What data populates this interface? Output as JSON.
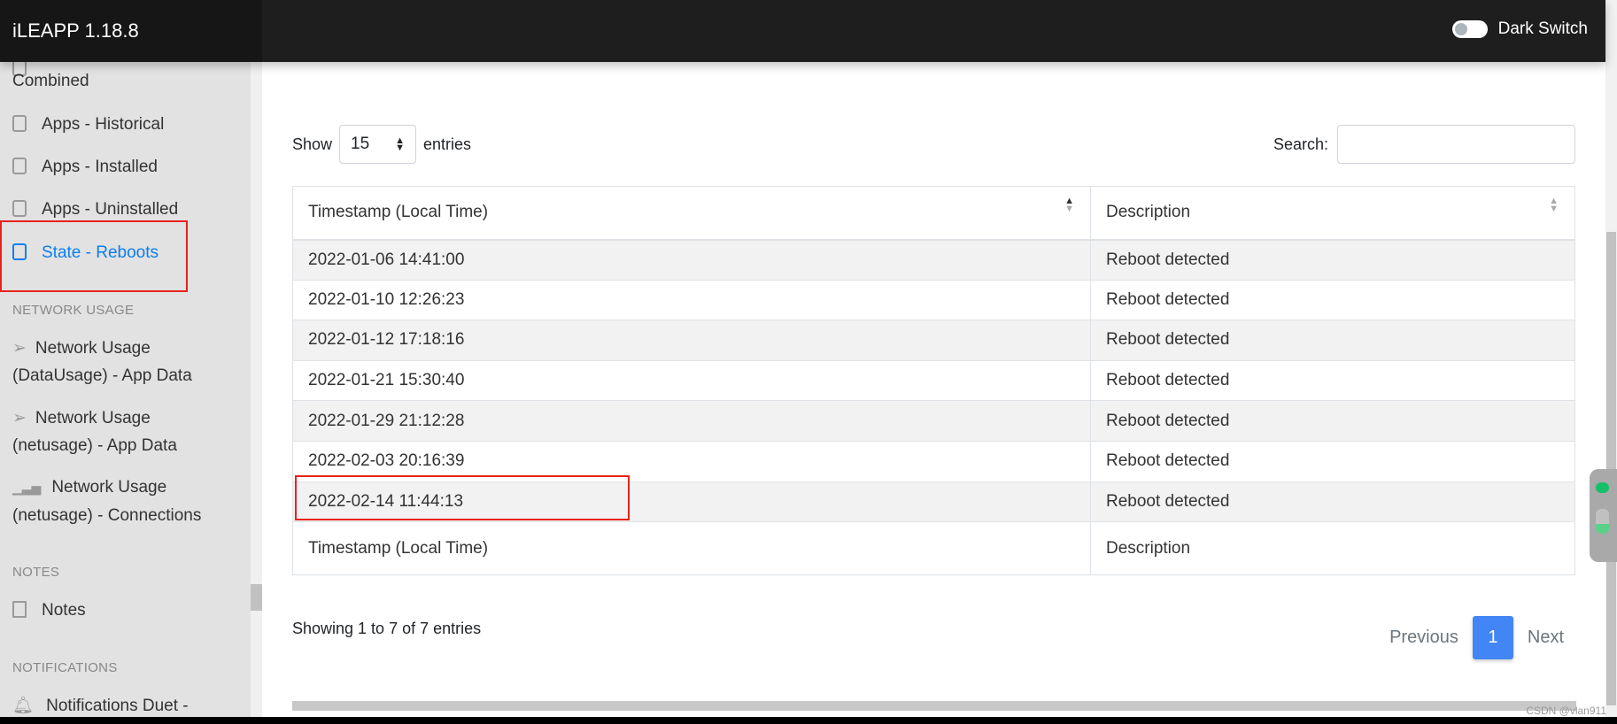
{
  "header": {
    "title": "iLEAPP 1.18.8",
    "dark_switch_label": "Dark Switch",
    "dark_switch_on": false
  },
  "sidebar": {
    "items": [
      {
        "label": "Combined"
      },
      {
        "label": "Apps - Historical",
        "icon": "clipboard-icon"
      },
      {
        "label": "Apps - Installed",
        "icon": "clipboard-icon"
      },
      {
        "label": "Apps - Uninstalled",
        "icon": "clipboard-icon"
      },
      {
        "label": "State - Reboots",
        "icon": "clipboard-icon",
        "active": true
      },
      {
        "label": "Network Usage (DataUsage) - App Data",
        "icon": "send-icon"
      },
      {
        "label": "Network Usage (netusage) - App Data",
        "icon": "send-icon"
      },
      {
        "label": "Network Usage (netusage) - Connections",
        "icon": "bar-chart-icon"
      },
      {
        "label": "Notes",
        "icon": "file-text-icon"
      },
      {
        "label": "Notifications Duet -",
        "icon": "bell-icon"
      }
    ],
    "sections": [
      "NETWORK USAGE",
      "NOTES",
      "NOTIFICATIONS"
    ]
  },
  "controls": {
    "show_label": "Show",
    "entries_value": "15",
    "entries_label": "entries",
    "search_label": "Search:",
    "search_value": ""
  },
  "table": {
    "columns": [
      "Timestamp (Local Time)",
      "Description"
    ],
    "rows": [
      [
        "2022-01-06 14:41:00",
        "Reboot detected"
      ],
      [
        "2022-01-10 12:26:23",
        "Reboot detected"
      ],
      [
        "2022-01-12 17:18:16",
        "Reboot detected"
      ],
      [
        "2022-01-21 15:30:40",
        "Reboot detected"
      ],
      [
        "2022-01-29 21:12:28",
        "Reboot detected"
      ],
      [
        "2022-02-03 20:16:39",
        "Reboot detected"
      ],
      [
        "2022-02-14 11:44:13",
        "Reboot detected"
      ]
    ]
  },
  "footer": {
    "info": "Showing 1 to 7 of 7 entries",
    "previous": "Previous",
    "page": "1",
    "next": "Next"
  },
  "watermark": "CSDN @vlan911",
  "colors": {
    "accent": "#0d7ff0",
    "page_active": "#4285f4",
    "highlight": "#e8231c"
  }
}
